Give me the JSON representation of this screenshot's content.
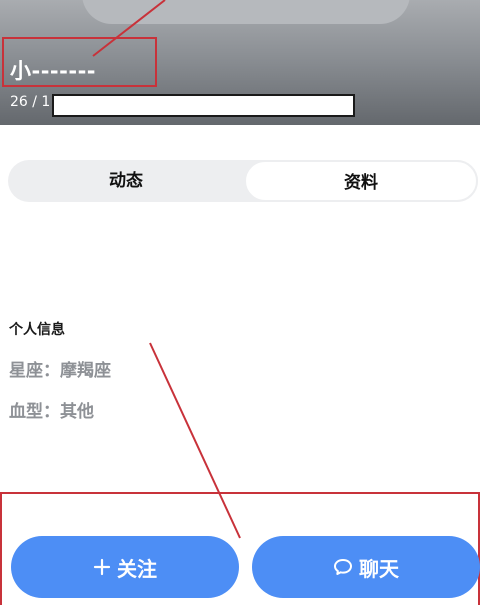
{
  "profile": {
    "name": "小-------",
    "meta_text": "26 / 1"
  },
  "tabs": [
    {
      "label": "动态",
      "selected": false
    },
    {
      "label": "资料",
      "selected": true
    }
  ],
  "info": {
    "title": "个人信息",
    "constellation": "星座：摩羯座",
    "blood_type": "血型：其他"
  },
  "actions": {
    "follow_label": "关注",
    "chat_label": "聊天"
  },
  "icons": {
    "follow": "plus-icon",
    "chat": "chat-bubble-icon"
  },
  "colors": {
    "accent": "#4d8ef5",
    "annotation": "#c8323a",
    "muted_text": "#8e9196",
    "tab_bg": "#edeef0"
  }
}
